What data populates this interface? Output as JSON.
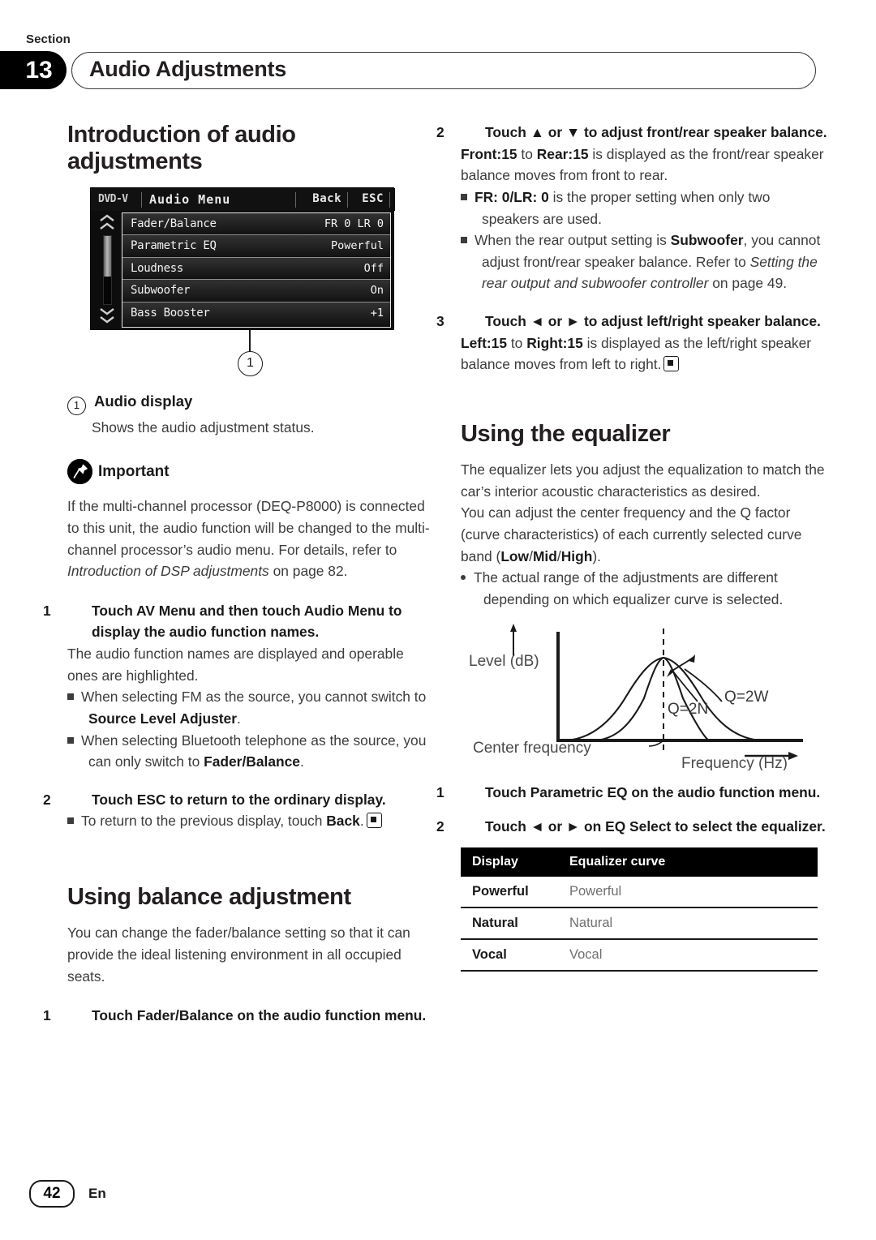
{
  "header": {
    "section_label": "Section",
    "section_number": "13",
    "section_title": "Audio Adjustments"
  },
  "left_column": {
    "heading": "Introduction of audio adjustments",
    "lcd": {
      "source": "DVD-V",
      "title": "Audio Menu",
      "back_label": "Back",
      "esc_label": "ESC",
      "rows": [
        {
          "name": "Fader/Balance",
          "value": "FR 0 LR 0"
        },
        {
          "name": "Parametric EQ",
          "value": "Powerful"
        },
        {
          "name": "Loudness",
          "value": "Off"
        },
        {
          "name": "Subwoofer",
          "value": "On"
        },
        {
          "name": "Bass Booster",
          "value": "+1"
        }
      ],
      "callout": "1"
    },
    "callout_marker": "1",
    "callout_title": "Audio display",
    "callout_desc": "Shows the audio adjustment status.",
    "important_label": "Important",
    "important_p1_a": "If the multi-channel processor (DEQ-P8000) is connected to this unit, the audio function will be changed to the multi-channel processor’s audio menu. For details, refer to ",
    "important_p1_i": "Introduction of DSP adjustments",
    "important_p1_b": " on page 82.",
    "step1_num": "1",
    "step1_text": "Touch AV Menu and then touch Audio Menu to display the audio function names.",
    "step1_body": "The audio function names are displayed and operable ones are highlighted.",
    "step1_note1_a": "When selecting FM as the source, you cannot switch to ",
    "step1_note1_b": "Source Level Adjuster",
    "step1_note1_c": ".",
    "step1_note2_a": "When selecting Bluetooth telephone as the source, you can only switch to ",
    "step1_note2_b": "Fader/Balance",
    "step1_note2_c": ".",
    "step2_num": "2",
    "step2_text": "Touch ESC to return to the ordinary display.",
    "step2_note_a": "To return to the previous display, touch ",
    "step2_note_b": "Back",
    "step2_note_c": ".",
    "heading2": "Using balance adjustment",
    "heading2_body": "You can change the fader/balance setting so that it can provide the ideal listening environment in all occupied seats.",
    "bal_step1_num": "1",
    "bal_step1_text": "Touch Fader/Balance on the audio function menu."
  },
  "right_column": {
    "step2_num": "2",
    "step2_text": "Touch ▲ or ▼ to adjust front/rear speaker balance.",
    "step2_body_a": "Front:15",
    "step2_body_b": " to ",
    "step2_body_c": "Rear:15",
    "step2_body_d": " is displayed as the front/rear speaker balance moves from front to rear.",
    "step2_note1_a": "FR: 0/LR: 0",
    "step2_note1_b": " is the proper setting when only two speakers are used.",
    "step2_note2_a": "When the rear output setting is ",
    "step2_note2_b": "Subwoofer",
    "step2_note2_c": ", you cannot adjust front/rear speaker balance. Refer to ",
    "step2_note2_i": "Setting the rear output and subwoofer controller",
    "step2_note2_d": " on page 49.",
    "step3_num": "3",
    "step3_text": "Touch ◄ or ► to adjust left/right speaker balance.",
    "step3_body_a": "Left:15",
    "step3_body_b": " to ",
    "step3_body_c": "Right:15",
    "step3_body_d": " is displayed as the left/right speaker balance moves from left to right.",
    "heading": "Using the equalizer",
    "body1": "The equalizer lets you adjust the equalization to match the car’s interior acoustic characteristics as desired.",
    "body2_a": "You can adjust the center frequency and the Q factor (curve characteristics) of each currently selected curve band (",
    "body2_low": "Low",
    "body2_s1": "/",
    "body2_mid": "Mid",
    "body2_s2": "/",
    "body2_high": "High",
    "body2_b": ").",
    "bullet1": "The actual range of the adjustments are different depending on which equalizer curve is selected.",
    "eq_step1_num": "1",
    "eq_step1_text": "Touch Parametric EQ on the audio function menu.",
    "eq_step2_num": "2",
    "eq_step2_text": "Touch ◄ or ► on EQ Select to select the equalizer.",
    "table": {
      "headers": [
        "Display",
        "Equalizer curve"
      ],
      "rows": [
        [
          "Powerful",
          "Powerful"
        ],
        [
          "Natural",
          "Natural"
        ],
        [
          "Vocal",
          "Vocal"
        ]
      ]
    }
  },
  "chart_data": {
    "type": "line",
    "title": "",
    "xlabel": "Frequency (Hz)",
    "ylabel": "Level (dB)",
    "annotations": [
      "Center frequency",
      "Q=2N",
      "Q=2W"
    ],
    "series": [
      {
        "name": "Q=2W",
        "description": "wide bell curve peaking at center frequency"
      },
      {
        "name": "Q=2N",
        "description": "narrow bell curve peaking at center frequency"
      }
    ],
    "grid": false,
    "legend": "inline-annotations"
  },
  "footer": {
    "page_number": "42",
    "language": "En"
  }
}
